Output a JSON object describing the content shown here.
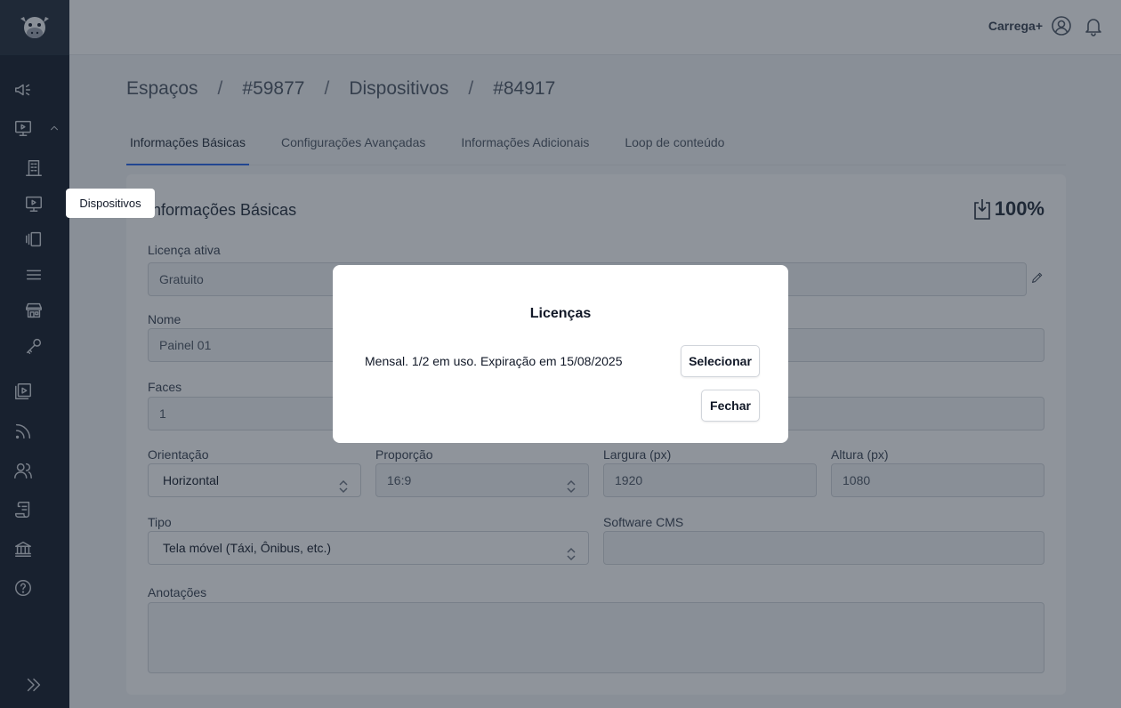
{
  "header": {
    "brand": "Carrega+",
    "icons": [
      "user-circle-icon",
      "bell-icon"
    ]
  },
  "sidebar": {
    "logo": "cow-logo",
    "items": [
      {
        "name": "megaphone-icon"
      },
      {
        "name": "monitor-play-icon"
      },
      {
        "name": "building-icon"
      },
      {
        "name": "monitor-icon"
      },
      {
        "name": "carousel-icon"
      },
      {
        "name": "menu-lines-icon"
      },
      {
        "name": "store-icon"
      },
      {
        "name": "key-icon"
      },
      {
        "name": "media-library-icon"
      },
      {
        "name": "rss-icon"
      },
      {
        "name": "users-icon"
      },
      {
        "name": "scroll-icon"
      },
      {
        "name": "bank-icon"
      },
      {
        "name": "help-circle-icon"
      },
      {
        "name": "expand-icon"
      }
    ],
    "tooltip": "Dispositivos"
  },
  "breadcrumb": [
    "Espaços",
    "#59877",
    "Dispositivos",
    "#84917"
  ],
  "tabs": [
    {
      "label": "Informações Básicas",
      "active": true
    },
    {
      "label": "Configurações Avançadas",
      "active": false
    },
    {
      "label": "Informações Adicionais",
      "active": false
    },
    {
      "label": "Loop de conteúdo",
      "active": false
    }
  ],
  "card": {
    "title": "Informações Básicas",
    "completion": "100%",
    "license_label": "Licença ativa",
    "license_value": "Gratuito",
    "name_label": "Nome",
    "name_value": "Painel 01",
    "faces_label": "Faces",
    "faces_value": "1",
    "orientation_label": "Orientação",
    "orientation_value": "Horizontal",
    "proportion_label": "Proporção",
    "proportion_value": "16:9",
    "width_label": "Largura (px)",
    "width_value": "1920",
    "height_label": "Altura (px)",
    "height_value": "1080",
    "type_label": "Tipo",
    "type_value": "Tela móvel (Táxi, Ônibus, etc.)",
    "cms_label": "Software CMS",
    "cms_value": "",
    "notes_label": "Anotações",
    "notes_value": ""
  },
  "modal": {
    "title": "Licenças",
    "license_text": "Mensal. 1/2 em uso. Expiração em 15/08/2025",
    "select_label": "Selecionar",
    "close_label": "Fechar"
  },
  "colors": {
    "sidebar_bg": "#111827",
    "tab_active": "#2563eb",
    "overlay": "rgba(31,41,55,0.5)"
  }
}
